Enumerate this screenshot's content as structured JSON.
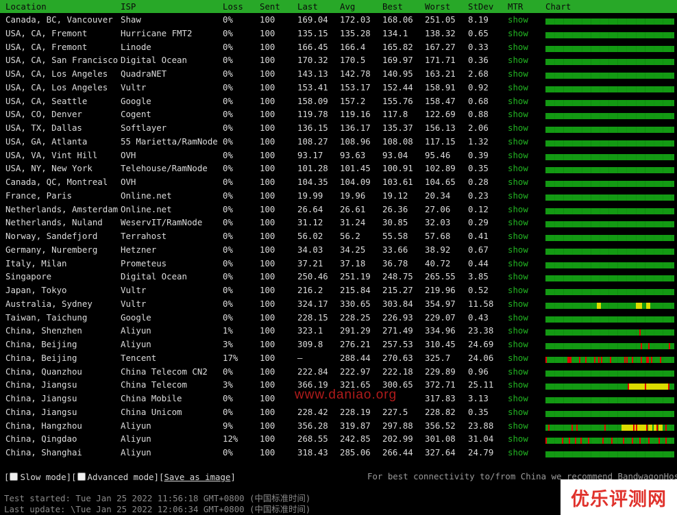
{
  "columns": [
    "Location",
    "ISP",
    "Loss",
    "Sent",
    "Last",
    "Avg",
    "Best",
    "Worst",
    "StDev",
    "MTR",
    "Chart"
  ],
  "mtr_link_label": "show",
  "colors": {
    "header_bg": "#28a828",
    "chart_ok": "#139a13",
    "chart_loss": "#e60000",
    "chart_warn": "#dcdc00",
    "link": "#22b422"
  },
  "rows": [
    {
      "location": "Canada, BC, Vancouver",
      "isp": "Shaw",
      "loss": "0%",
      "sent": "100",
      "last": "169.04",
      "avg": "172.03",
      "best": "168.06",
      "worst": "251.05",
      "stdev": "8.19",
      "ticks": [],
      "yellow": []
    },
    {
      "location": "USA, CA, Fremont",
      "isp": "Hurricane FMT2",
      "loss": "0%",
      "sent": "100",
      "last": "135.15",
      "avg": "135.28",
      "best": "134.1",
      "worst": "138.32",
      "stdev": "0.65",
      "ticks": [],
      "yellow": []
    },
    {
      "location": "USA, CA, Fremont",
      "isp": "Linode",
      "loss": "0%",
      "sent": "100",
      "last": "166.45",
      "avg": "166.4",
      "best": "165.82",
      "worst": "167.27",
      "stdev": "0.33",
      "ticks": [],
      "yellow": []
    },
    {
      "location": "USA, CA, San Francisco",
      "isp": "Digital Ocean",
      "loss": "0%",
      "sent": "100",
      "last": "170.32",
      "avg": "170.5",
      "best": "169.97",
      "worst": "171.71",
      "stdev": "0.36",
      "ticks": [],
      "yellow": []
    },
    {
      "location": "USA, CA, Los Angeles",
      "isp": "QuadraNET",
      "loss": "0%",
      "sent": "100",
      "last": "143.13",
      "avg": "142.78",
      "best": "140.95",
      "worst": "163.21",
      "stdev": "2.68",
      "ticks": [],
      "yellow": []
    },
    {
      "location": "USA, CA, Los Angeles",
      "isp": "Vultr",
      "loss": "0%",
      "sent": "100",
      "last": "153.41",
      "avg": "153.17",
      "best": "152.44",
      "worst": "158.91",
      "stdev": "0.92",
      "ticks": [],
      "yellow": []
    },
    {
      "location": "USA, CA, Seattle",
      "isp": "Google",
      "loss": "0%",
      "sent": "100",
      "last": "158.09",
      "avg": "157.2",
      "best": "155.76",
      "worst": "158.47",
      "stdev": "0.68",
      "ticks": [],
      "yellow": []
    },
    {
      "location": "USA, CO, Denver",
      "isp": "Cogent",
      "loss": "0%",
      "sent": "100",
      "last": "119.78",
      "avg": "119.16",
      "best": "117.8",
      "worst": "122.69",
      "stdev": "0.88",
      "ticks": [],
      "yellow": []
    },
    {
      "location": "USA, TX, Dallas",
      "isp": "Softlayer",
      "loss": "0%",
      "sent": "100",
      "last": "136.15",
      "avg": "136.17",
      "best": "135.37",
      "worst": "156.13",
      "stdev": "2.06",
      "ticks": [],
      "yellow": []
    },
    {
      "location": "USA, GA, Atlanta",
      "isp": "55 Marietta/RamNode",
      "loss": "0%",
      "sent": "100",
      "last": "108.27",
      "avg": "108.96",
      "best": "108.08",
      "worst": "117.15",
      "stdev": "1.32",
      "ticks": [],
      "yellow": []
    },
    {
      "location": "USA, VA, Vint Hill",
      "isp": "OVH",
      "loss": "0%",
      "sent": "100",
      "last": "93.17",
      "avg": "93.63",
      "best": "93.04",
      "worst": "95.46",
      "stdev": "0.39",
      "ticks": [],
      "yellow": []
    },
    {
      "location": "USA, NY, New York",
      "isp": "Telehouse/RamNode",
      "loss": "0%",
      "sent": "100",
      "last": "101.28",
      "avg": "101.45",
      "best": "100.91",
      "worst": "102.89",
      "stdev": "0.35",
      "ticks": [],
      "yellow": []
    },
    {
      "location": "Canada, QC, Montreal",
      "isp": "OVH",
      "loss": "0%",
      "sent": "100",
      "last": "104.35",
      "avg": "104.09",
      "best": "103.61",
      "worst": "104.65",
      "stdev": "0.28",
      "ticks": [],
      "yellow": []
    },
    {
      "location": "France, Paris",
      "isp": "Online.net",
      "loss": "0%",
      "sent": "100",
      "last": "19.99",
      "avg": "19.96",
      "best": "19.12",
      "worst": "20.34",
      "stdev": "0.23",
      "ticks": [],
      "yellow": []
    },
    {
      "location": "Netherlands, Amsterdam",
      "isp": "Online.net",
      "loss": "0%",
      "sent": "100",
      "last": "26.64",
      "avg": "26.61",
      "best": "26.36",
      "worst": "27.06",
      "stdev": "0.12",
      "ticks": [],
      "yellow": []
    },
    {
      "location": "Netherlands, Nuland",
      "isp": "WeservIT/RamNode",
      "loss": "0%",
      "sent": "100",
      "last": "31.12",
      "avg": "31.24",
      "best": "30.85",
      "worst": "32.03",
      "stdev": "0.29",
      "ticks": [],
      "yellow": []
    },
    {
      "location": "Norway, Sandefjord",
      "isp": "Terrahost",
      "loss": "0%",
      "sent": "100",
      "last": "56.02",
      "avg": "56.2",
      "best": "55.58",
      "worst": "57.68",
      "stdev": "0.41",
      "ticks": [],
      "yellow": []
    },
    {
      "location": "Germany, Nuremberg",
      "isp": "Hetzner",
      "loss": "0%",
      "sent": "100",
      "last": "34.03",
      "avg": "34.25",
      "best": "33.66",
      "worst": "38.92",
      "stdev": "0.67",
      "ticks": [],
      "yellow": []
    },
    {
      "location": "Italy, Milan",
      "isp": "Prometeus",
      "loss": "0%",
      "sent": "100",
      "last": "37.21",
      "avg": "37.18",
      "best": "36.78",
      "worst": "40.72",
      "stdev": "0.44",
      "ticks": [],
      "yellow": []
    },
    {
      "location": "Singapore",
      "isp": "Digital Ocean",
      "loss": "0%",
      "sent": "100",
      "last": "250.46",
      "avg": "251.19",
      "best": "248.75",
      "worst": "265.55",
      "stdev": "3.85",
      "ticks": [],
      "yellow": []
    },
    {
      "location": "Japan, Tokyo",
      "isp": "Vultr",
      "loss": "0%",
      "sent": "100",
      "last": "216.2",
      "avg": "215.84",
      "best": "215.27",
      "worst": "219.96",
      "stdev": "0.52",
      "ticks": [],
      "yellow": []
    },
    {
      "location": "Australia, Sydney",
      "isp": "Vultr",
      "loss": "0%",
      "sent": "100",
      "last": "324.17",
      "avg": "330.65",
      "best": "303.84",
      "worst": "354.97",
      "stdev": "11.58",
      "ticks": [],
      "yellow": [
        40,
        70,
        71,
        72,
        78
      ]
    },
    {
      "location": "Taiwan, Taichung",
      "isp": "Google",
      "loss": "0%",
      "sent": "100",
      "last": "228.15",
      "avg": "228.25",
      "best": "226.93",
      "worst": "229.07",
      "stdev": "0.43",
      "ticks": [],
      "yellow": []
    },
    {
      "location": "China, Shenzhen",
      "isp": "Aliyun",
      "loss": "1%",
      "sent": "100",
      "last": "323.1",
      "avg": "291.29",
      "best": "271.49",
      "worst": "334.96",
      "stdev": "23.38",
      "ticks": [
        73
      ],
      "yellow": []
    },
    {
      "location": "China, Beijing",
      "isp": "Aliyun",
      "loss": "3%",
      "sent": "100",
      "last": "309.8",
      "avg": "276.21",
      "best": "257.53",
      "worst": "310.45",
      "stdev": "24.69",
      "ticks": [
        74,
        80,
        96
      ],
      "yellow": []
    },
    {
      "location": "China, Beijing",
      "isp": "Tencent",
      "loss": "17%",
      "sent": "100",
      "last": "–",
      "avg": "288.44",
      "best": "270.63",
      "worst": "325.7",
      "stdev": "24.06",
      "ticks": [
        0,
        17,
        18,
        19,
        26,
        31,
        38,
        41,
        43,
        50,
        61,
        63,
        67,
        74,
        78,
        79,
        82,
        89
      ],
      "yellow": []
    },
    {
      "location": "China, Quanzhou",
      "isp": "China Telecom CN2",
      "loss": "0%",
      "sent": "100",
      "last": "222.84",
      "avg": "222.97",
      "best": "222.18",
      "worst": "229.89",
      "stdev": "0.96",
      "ticks": [],
      "yellow": []
    },
    {
      "location": "China, Jiangsu",
      "isp": "China Telecom",
      "loss": "3%",
      "sent": "100",
      "last": "366.19",
      "avg": "321.65",
      "best": "300.65",
      "worst": "372.71",
      "stdev": "25.11",
      "ticks": [
        64,
        77,
        95
      ],
      "yellow": [
        65,
        68,
        71,
        74,
        78,
        81,
        84,
        87,
        90,
        93
      ]
    },
    {
      "location": "China, Jiangsu",
      "isp": "China Mobile",
      "loss": "0%",
      "sent": "100",
      "last": "",
      "avg": "",
      "best": "",
      "worst": "317.83",
      "stdev": "3.13",
      "ticks": [],
      "yellow": []
    },
    {
      "location": "China, Jiangsu",
      "isp": "China Unicom",
      "loss": "0%",
      "sent": "100",
      "last": "228.42",
      "avg": "228.19",
      "best": "227.5",
      "worst": "228.82",
      "stdev": "0.35",
      "ticks": [],
      "yellow": []
    },
    {
      "location": "China, Hangzhou",
      "isp": "Aliyun",
      "loss": "9%",
      "sent": "100",
      "last": "356.28",
      "avg": "319.87",
      "best": "297.88",
      "worst": "356.52",
      "stdev": "23.88",
      "ticks": [
        2,
        20,
        24,
        46,
        68,
        70,
        78,
        86,
        93
      ],
      "yellow": [
        59,
        62,
        65,
        69,
        72,
        75,
        80,
        84,
        88
      ]
    },
    {
      "location": "China, Qingdao",
      "isp": "Aliyun",
      "loss": "12%",
      "sent": "100",
      "last": "268.55",
      "avg": "242.85",
      "best": "202.99",
      "worst": "301.08",
      "stdev": "31.04",
      "ticks": [
        0,
        13,
        18,
        23,
        27,
        33,
        44,
        51,
        60,
        67,
        73,
        80,
        88,
        93
      ],
      "yellow": []
    },
    {
      "location": "China, Shanghai",
      "isp": "Aliyun",
      "loss": "0%",
      "sent": "100",
      "last": "318.43",
      "avg": "285.06",
      "best": "266.44",
      "worst": "327.64",
      "stdev": "24.79",
      "ticks": [],
      "yellow": []
    }
  ],
  "controls": {
    "slow_mode": "Slow mode",
    "advanced_mode": "Advanced mode",
    "save_image": "Save as image"
  },
  "recommend_text": "For best connectivity to/from China we recommend BandwagonHost",
  "status": {
    "started": "Test started: Tue Jan 25 2022 11:56:18 GMT+0800 (中国标准时间)",
    "updated": "Last update: \\Tue Jan 25 2022 12:06:34 GMT+0800 (中国标准时间)"
  },
  "watermark": "www.daniao.org",
  "logo": "优乐评测网"
}
